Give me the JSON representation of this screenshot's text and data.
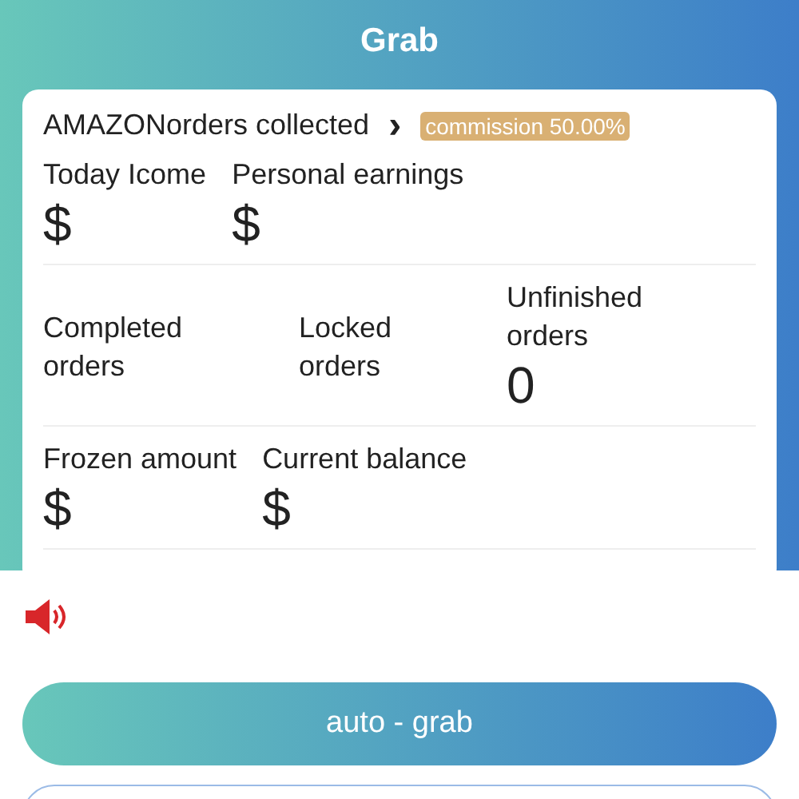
{
  "header": {
    "title": "Grab"
  },
  "card": {
    "title": "AMAZONorders collected",
    "chevron": "›",
    "badge": "commission 50.00%",
    "rows": [
      [
        {
          "label": "Today Icome",
          "value": "$"
        },
        {
          "label": "Personal earnings",
          "value": "$"
        }
      ],
      [
        {
          "label": "Completed orders"
        },
        {
          "label": "Locked orders"
        },
        {
          "label": "Unfinished orders",
          "value": "0"
        }
      ],
      [
        {
          "label": "Frozen amount",
          "value": "$"
        },
        {
          "label": "Current balance",
          "value": "$"
        }
      ]
    ]
  },
  "sound": {
    "on": true
  },
  "buttons": [
    "auto - grab"
  ]
}
